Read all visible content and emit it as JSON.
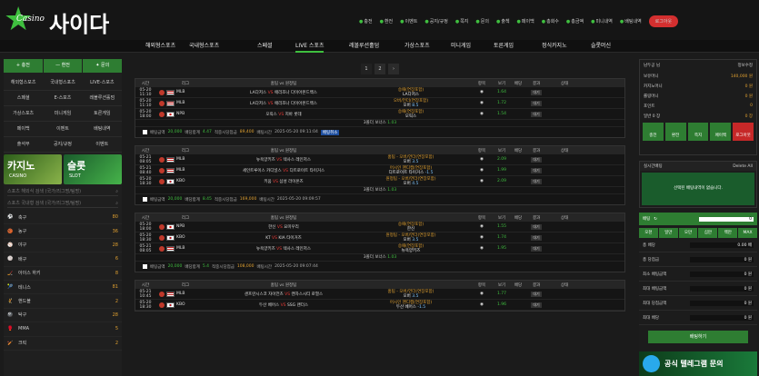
{
  "brand": {
    "small": "Casino",
    "name": "사이다"
  },
  "top_nav": [
    {
      "icon": "●",
      "label": "충전"
    },
    {
      "icon": "●",
      "label": "환전"
    },
    {
      "icon": "●",
      "label": "이벤트"
    },
    {
      "icon": "●",
      "label": "공지/규정"
    },
    {
      "icon": "●",
      "label": "쪽지"
    },
    {
      "icon": "●",
      "label": "문의"
    },
    {
      "icon": "●",
      "label": "출첵"
    },
    {
      "icon": "●",
      "label": "페이백"
    },
    {
      "icon": "●",
      "label": "총회수"
    },
    {
      "icon": "●",
      "label": "총금액"
    },
    {
      "icon": "●",
      "label": "미니내역"
    },
    {
      "icon": "●",
      "label": "배팅내역"
    }
  ],
  "logout": "로그아웃",
  "main_nav": [
    "해외형스포츠",
    "국내형스포츠",
    "스페셜",
    "LIVE 스포츠",
    "레볼루션홀덤",
    "가상스포츠",
    "미니게임",
    "토른게임",
    "정식카지노",
    "슬롯머신"
  ],
  "left": {
    "buttons": [
      "+ 충전",
      "— 환전",
      "✦ 문의"
    ],
    "grid": [
      "해외형스포츠",
      "국내형스포츠",
      "LIVE-스포츠",
      "스페셜",
      "E-스포츠",
      "레볼루션홀덤",
      "가상스포츠",
      "미니게임",
      "토른게임",
      "페이백",
      "이벤트",
      "배팅내역",
      "출석부",
      "공지/규정",
      "이벤트"
    ],
    "banners": [
      {
        "big": "카지노",
        "small": "CASINO"
      },
      {
        "big": "슬롯",
        "small": "SLOT"
      }
    ],
    "search1": "스포츠 해외식 검색 (국가/리그명/팀명)",
    "search2": "스포츠 국내형 검색 (국가/리그명/팀명)",
    "sports": [
      {
        "icon": "⚽",
        "name": "축구",
        "count": "80"
      },
      {
        "icon": "🏀",
        "name": "농구",
        "count": "36"
      },
      {
        "icon": "⚾",
        "name": "야구",
        "count": "28"
      },
      {
        "icon": "🏐",
        "name": "배구",
        "count": "6"
      },
      {
        "icon": "🏒",
        "name": "아이스 하키",
        "count": "8"
      },
      {
        "icon": "🎾",
        "name": "테니스",
        "count": "81"
      },
      {
        "icon": "🤾",
        "name": "핸드볼",
        "count": "2"
      },
      {
        "icon": "🎱",
        "name": "탁구",
        "count": "28"
      },
      {
        "icon": "🥊",
        "name": "MMA",
        "count": "5"
      },
      {
        "icon": "🏏",
        "name": "크릭",
        "count": "2"
      }
    ]
  },
  "pages": [
    "1",
    "2",
    "›"
  ],
  "headers": [
    "시간",
    "리그",
    "홈팀 vs 원정팀",
    "항목",
    "보기",
    "배당",
    "결과",
    "상태"
  ],
  "blocks": [
    {
      "games": [
        {
          "time": "05-20\n11:10",
          "flag": "usa",
          "league": "MLB",
          "home": "LA다저스",
          "away": "애리조나 다이아몬드백스",
          "bet_market": "승패(연장포함)",
          "bet_sel": "LA다저스",
          "bet_detail": "",
          "odds": "1.64",
          "status": "대기"
        },
        {
          "time": "05-20\n11:10",
          "flag": "usa",
          "league": "MLB",
          "home": "LA다저스",
          "away": "애리조나 다이아몬드백스",
          "bet_market": "오버/언더(연장포함)",
          "bet_sel": "오버",
          "bet_detail": "8.5",
          "odds": "1.72",
          "status": "대기"
        },
        {
          "time": "05-20\n18:00",
          "flag": "jpn",
          "league": "NPB",
          "home": "오릭스",
          "away": "지바 롯데",
          "bet_market": "승패(연장포함)",
          "bet_sel": "오릭스",
          "bet_detail": "",
          "odds": "1.54",
          "status": "대기"
        }
      ],
      "bonus_label": "3폴더 보너스",
      "bonus": "1.03",
      "amount": "20,000",
      "total": "4.47",
      "win": "89,400",
      "placed": "2025-05-20 09:11:04",
      "tag": "배팅취소"
    },
    {
      "games": [
        {
          "time": "05-21\n08:05",
          "flag": "usa",
          "league": "MLB",
          "home": "뉴욕양키즈",
          "away": "텍사스 레인저스",
          "bet_market": "홈팀 - 오버/언더(연장포함)",
          "bet_sel": "오버",
          "bet_detail": "3.5",
          "odds": "2.09",
          "status": "대기"
        },
        {
          "time": "05-21\n08:40",
          "flag": "usa",
          "league": "MLB",
          "home": "세인트루이스 카디널스",
          "away": "디트로이트 타이거스",
          "bet_market": "어시인 핸디캡(연장포함)",
          "bet_sel": "디트로이트 타이거스",
          "bet_detail": "-1.5",
          "odds": "1.99",
          "status": "대기"
        },
        {
          "time": "05-20\n18:30",
          "flag": "kor",
          "league": "KBO",
          "home": "키움",
          "away": "삼성 라이온즈",
          "bet_market": "원정팀 - 오버/언더(연장포함)",
          "bet_sel": "오버",
          "bet_detail": "4.5",
          "odds": "2.09",
          "status": "대기"
        }
      ],
      "bonus_label": "3폴더 보너스",
      "bonus": "1.03",
      "amount": "20,000",
      "total": "8.45",
      "win": "169,000",
      "placed": "2025-05-20 09:09:57",
      "tag": ""
    },
    {
      "games": [
        {
          "time": "05-20\n18:00",
          "flag": "jpn",
          "league": "NPB",
          "home": "한신",
          "away": "요미우리",
          "bet_market": "승패(연장포함)",
          "bet_sel": "한신",
          "bet_detail": "",
          "odds": "1.55",
          "status": "대기"
        },
        {
          "time": "05-20\n18:30",
          "flag": "kor",
          "league": "KBO",
          "home": "KT",
          "away": "KIA 타이거즈",
          "bet_market": "원정팀 - 오버/언더(연장포함)",
          "bet_sel": "오버",
          "bet_detail": "3.5",
          "odds": "1.74",
          "status": "대기"
        },
        {
          "time": "05-21\n08:05",
          "flag": "usa",
          "league": "MLB",
          "home": "뉴욕양키즈",
          "away": "텍사스 레인저스",
          "bet_market": "승패(연장포함)",
          "bet_sel": "뉴욕양키즈",
          "bet_detail": "",
          "odds": "1.95",
          "status": "대기"
        }
      ],
      "bonus_label": "3폴더 보너스",
      "bonus": "1.03",
      "amount": "20,000",
      "total": "5.4",
      "win": "108,000",
      "placed": "2025-05-20 09:07:44",
      "tag": ""
    },
    {
      "games": [
        {
          "time": "05-21\n10:45",
          "flag": "usa",
          "league": "MLB",
          "home": "샌프란시스코 자이언츠",
          "away": "캔자스시티 로열스",
          "bet_market": "홈팀 - 오버/언더(연장포함)",
          "bet_sel": "오버",
          "bet_detail": "3.5",
          "odds": "1.77",
          "status": "대기"
        },
        {
          "time": "05-20\n18:30",
          "flag": "kor",
          "league": "KBO",
          "home": "두산 베어스",
          "away": "SSG 랜더스",
          "bet_market": "어시인 핸디캡(연장포함)",
          "bet_sel": "두산 베어스",
          "bet_detail": "-1.5",
          "odds": "1.96",
          "status": "대기"
        }
      ],
      "bonus_label": "",
      "bonus": "",
      "amount": "",
      "total": "",
      "win": "",
      "placed": "",
      "tag": ""
    }
  ],
  "labels": {
    "amount": "배팅금액",
    "total": "배당합계",
    "win": "적중시당첨금",
    "placed": "배팅시간",
    "vs": "VS"
  },
  "right": {
    "user_name": "남두공 님",
    "change_pw": "정보수정",
    "rows": [
      {
        "k": "보유머니",
        "v": "140,000 원"
      },
      {
        "k": "카지노머니",
        "v": "0 원"
      },
      {
        "k": "롤링머니",
        "v": "0 원"
      },
      {
        "k": "포인트",
        "v": "0"
      },
      {
        "k": "일반 0 장",
        "v": "0 장"
      }
    ],
    "buttons": [
      "충전",
      "환전",
      "쪽지",
      "페이백",
      "로그아웃"
    ],
    "slip_title": "실시간배팅",
    "slip_clear": "Delete All",
    "slip_msg": "선택된 배팅내역이 없습니다.",
    "cart_label": "배팅",
    "cart_value": "0",
    "quick": [
      "오천",
      "일만",
      "오만",
      "십만",
      "백만",
      "MAX"
    ],
    "stats": [
      {
        "k": "총 배당",
        "v": "0.00 배"
      },
      {
        "k": "총 당첨금",
        "v": "0 원"
      },
      {
        "k": "최소 배팅금액",
        "v": "0 원"
      },
      {
        "k": "최대 배팅금액",
        "v": "0 원"
      },
      {
        "k": "최대 당첨금액",
        "v": "0 원"
      },
      {
        "k": "최대 배당",
        "v": "0 원"
      }
    ],
    "bet_button": "배팅하기",
    "telegram": "공식 텔레그램 문의"
  }
}
